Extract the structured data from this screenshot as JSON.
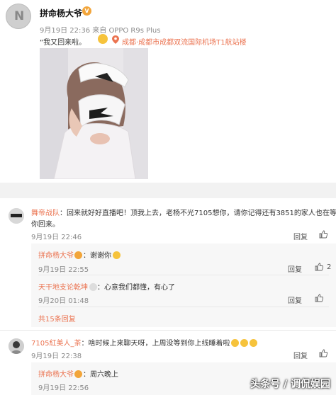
{
  "post": {
    "avatar_letter": "N",
    "author": "拼命杨大爷",
    "badge": "V",
    "meta": "9月19日 22:36 来自 OPPO R9s Plus",
    "text": "“我又回来啦。",
    "location": "成都·成都市成都双流国际机场T1航站楼"
  },
  "comments": [
    {
      "name": "舞帝战队",
      "text_line1": "：回来就好好直播吧！顶我上去，老杨不光7105想你，请你记得还有3851的家人也在等",
      "text_line2": "你回来。",
      "time": "9月19日 22:46",
      "reply_label": "回复",
      "replies": [
        {
          "name": "拼命杨大爷",
          "text": "：谢谢你",
          "time": "9月19日 22:55",
          "reply_label": "回复",
          "likes": "2"
        },
        {
          "name": "天干地支论乾坤",
          "text": "：心意我们都懂，有心了",
          "time": "9月20日 01:48",
          "reply_label": "回复",
          "likes": ""
        }
      ],
      "more": "共15条回复"
    },
    {
      "name": "7105紅美人_茶",
      "text": "：啥时候上来聊天呀，上周没等到你上线睡着啦",
      "time": "9月19日 22:38",
      "reply_label": "回复",
      "replies": [
        {
          "name": "拼命杨大爷",
          "text": "：周六晚上",
          "time": "9月19日 22:56",
          "reply_label": "",
          "likes": ""
        }
      ]
    }
  ],
  "watermark": "头条号 / 调侃娱园",
  "colors": {
    "accent": "#eb7350",
    "meta": "#8a8a8a",
    "subbg": "#f7f7f7"
  }
}
